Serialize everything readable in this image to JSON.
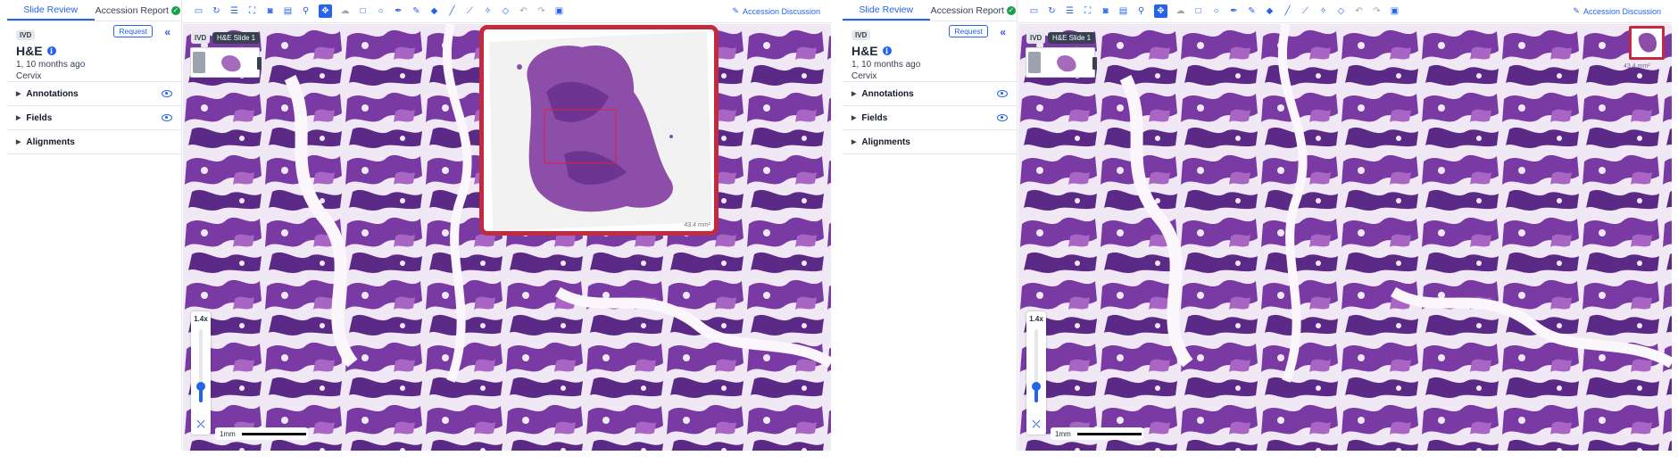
{
  "panes": [
    {
      "id": "left",
      "tabs": {
        "slide_review": "Slide Review",
        "accession_report": "Accession Report"
      },
      "slide": {
        "badge": "IVD",
        "title": "H&E",
        "age": "1, 10 months ago",
        "site": "Cervix",
        "request_label": "Request"
      },
      "sections": [
        "Annotations",
        "Fields",
        "Alignments"
      ],
      "toolbar": {
        "discussion_label": "Accession Discussion"
      },
      "viewer": {
        "chip_ivd": "IVD",
        "slide_label": "H&E Slide 1",
        "zoom_level": "1.4x",
        "zoom_fraction": 0.22,
        "scale_label": "1mm",
        "area_label": "43.4 mm²",
        "overview_expanded": true
      }
    },
    {
      "id": "right",
      "tabs": {
        "slide_review": "Slide Review",
        "accession_report": "Accession Report"
      },
      "slide": {
        "badge": "IVD",
        "title": "H&E",
        "age": "1, 10 months ago",
        "site": "Cervix",
        "request_label": "Request"
      },
      "sections": [
        "Annotations",
        "Fields",
        "Alignments"
      ],
      "toolbar": {
        "discussion_label": "Accession Discussion"
      },
      "viewer": {
        "chip_ivd": "IVD",
        "slide_label": "H&E Slide 1",
        "zoom_level": "1.4x",
        "zoom_fraction": 0.22,
        "scale_label": "1mm",
        "area_label": "43.4 mm²",
        "overview_expanded": false
      }
    }
  ],
  "colors": {
    "accent": "#2563eb",
    "overview_border": "#c12a3f",
    "tissue_dark": "#5b2a86",
    "tissue_mid": "#8e4bb0",
    "tissue_light": "#eadff0",
    "success": "#16a34a"
  },
  "icons": [
    "monitor-icon",
    "rotate-icon",
    "list-icon",
    "expand-icon",
    "camera-icon",
    "keyboard-icon",
    "microscope-icon",
    "move-icon",
    "cloud-icon",
    "rectangle-icon",
    "ellipse-icon",
    "pen-icon",
    "brush-icon",
    "eraser-icon",
    "ruler-icon",
    "line-icon",
    "magic-icon",
    "polygon-icon",
    "undo-icon",
    "redo-icon",
    "layout-icon",
    "edit-icon"
  ]
}
